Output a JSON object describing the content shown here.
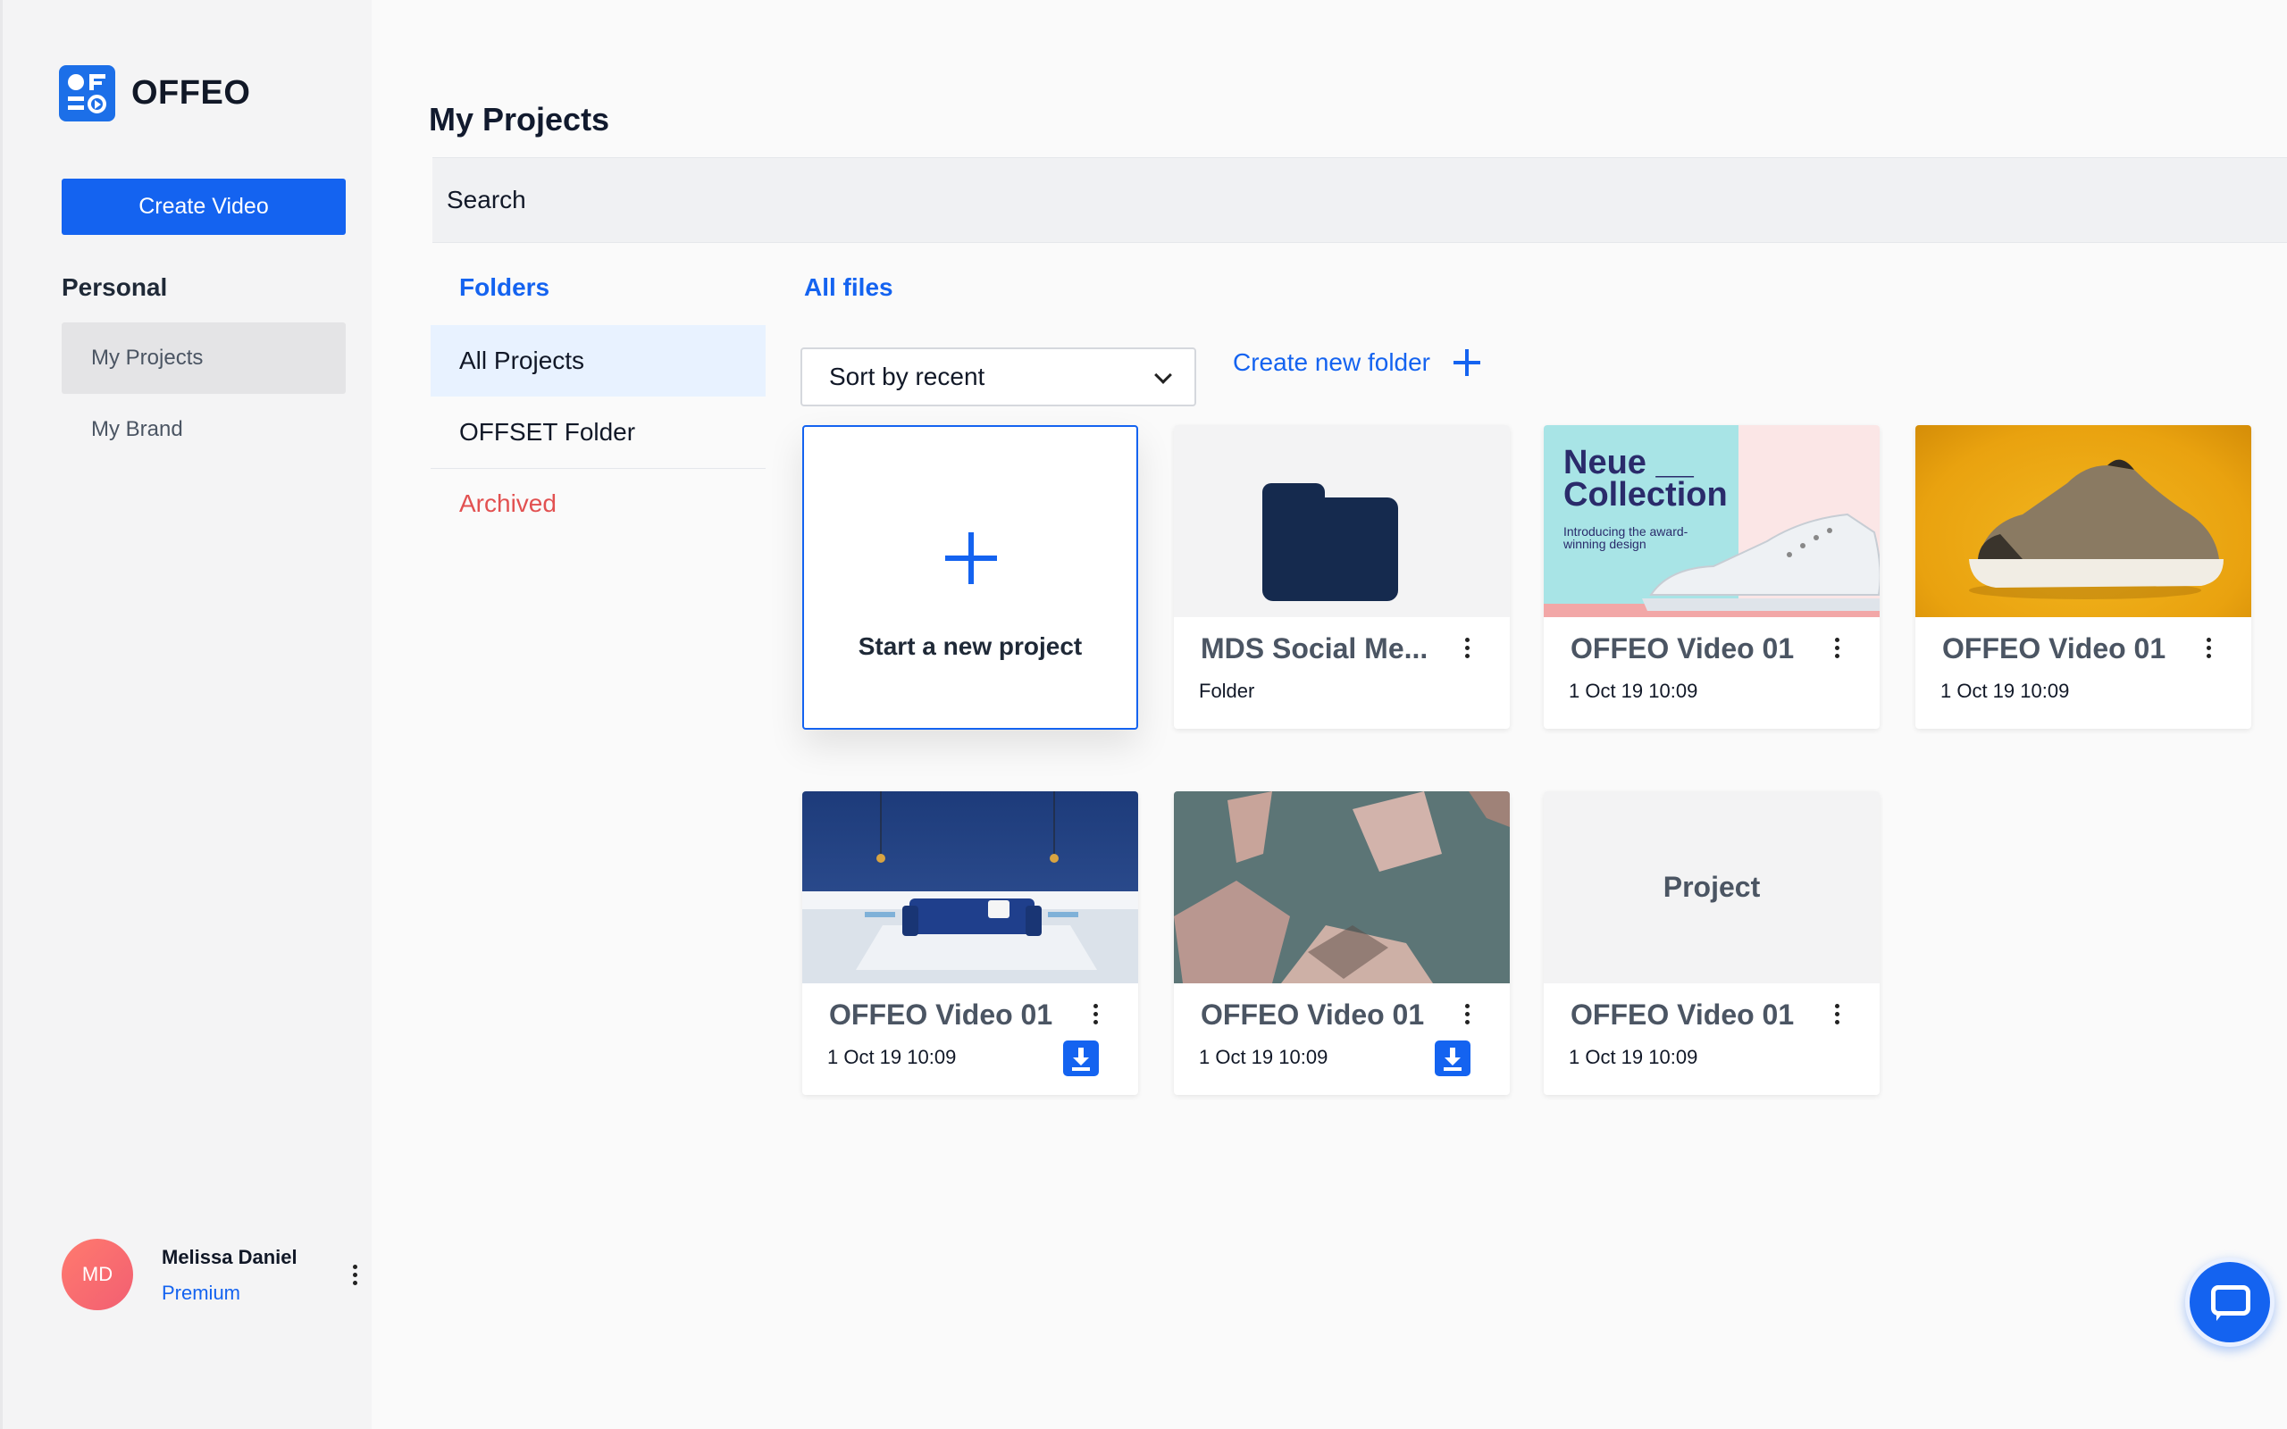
{
  "brand": {
    "name": "OFFEO"
  },
  "sidebar": {
    "create_label": "Create Video",
    "section": "Personal",
    "items": [
      {
        "label": "My Projects",
        "active": true
      },
      {
        "label": "My Brand",
        "active": false
      }
    ],
    "user": {
      "initials": "MD",
      "name": "Melissa Daniel",
      "plan": "Premium"
    }
  },
  "main": {
    "title": "My Projects",
    "search_placeholder": "Search",
    "folders_title": "Folders",
    "folders": [
      {
        "label": "All Projects",
        "active": true
      },
      {
        "label": "OFFSET Folder"
      },
      {
        "label": "Archived"
      }
    ],
    "files_title": "All files",
    "sort_label": "Sort by recent",
    "new_folder_label": "Create new folder",
    "new_project_label": "Start a new project",
    "cards": [
      {
        "title": "MDS Social Me...",
        "sub": "Folder",
        "thumb": "folder"
      },
      {
        "title": "OFFEO Video 01",
        "sub": "1 Oct 19 10:09",
        "thumb": "neue-collection"
      },
      {
        "title": "OFFEO Video 01",
        "sub": "1 Oct 19 10:09",
        "thumb": "sneaker"
      },
      {
        "title": "OFFEO Video 01",
        "sub": "1 Oct 19 10:09",
        "thumb": "living-room",
        "download": true
      },
      {
        "title": "OFFEO Video 01",
        "sub": "1 Oct 19 10:09",
        "thumb": "geometric",
        "download": true
      },
      {
        "title": "OFFEO Video 01",
        "sub": "1 Oct 19 10:09",
        "thumb": "project-placeholder"
      }
    ],
    "neue": {
      "title_line1": "Neue __",
      "title_line2": "Collection",
      "subtitle": "Introducing the award-winning design"
    },
    "project_placeholder_label": "Project"
  },
  "colors": {
    "accent": "#1463f0",
    "archived": "#e25151",
    "navy": "#152a4e"
  }
}
